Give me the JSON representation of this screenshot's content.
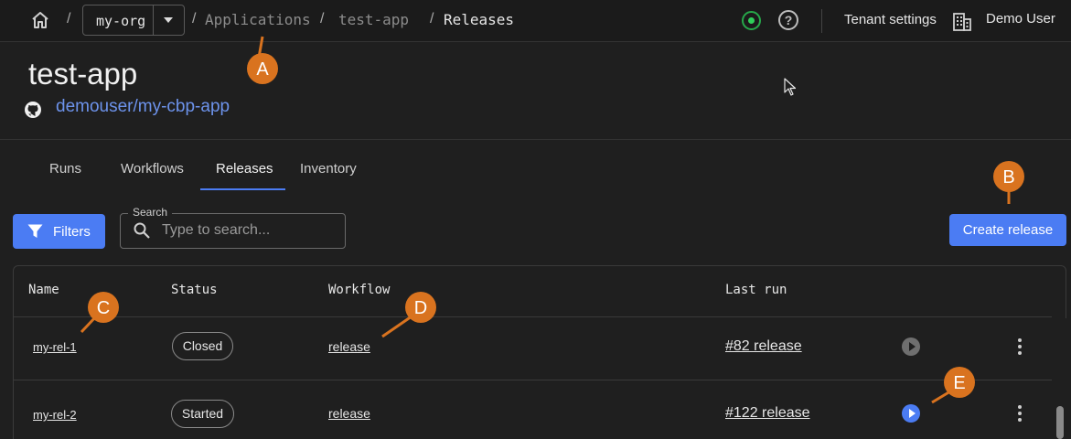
{
  "topbar": {
    "org": "my-org",
    "breadcrumbs": [
      "Applications",
      "test-app",
      "Releases"
    ],
    "separator": "/",
    "tenant_settings": "Tenant settings",
    "user": "Demo User",
    "help_glyph": "?"
  },
  "header": {
    "title": "test-app",
    "repo": "demouser/my-cbp-app"
  },
  "tabs": [
    {
      "label": "Runs",
      "active": false
    },
    {
      "label": "Workflows",
      "active": false
    },
    {
      "label": "Releases",
      "active": true
    },
    {
      "label": "Inventory",
      "active": false
    }
  ],
  "toolbar": {
    "filters_label": "Filters",
    "search_label": "Search",
    "search_placeholder": "Type to search...",
    "create_label": "Create release"
  },
  "table": {
    "columns": [
      "Name",
      "Status",
      "Workflow",
      "Last run"
    ],
    "rows": [
      {
        "name": "my-rel-1",
        "status": "Closed",
        "workflow": "release",
        "last_run": "#82 release",
        "play_state": "disabled"
      },
      {
        "name": "my-rel-2",
        "status": "Started",
        "workflow": "release",
        "last_run": "#122 release",
        "play_state": "enabled"
      }
    ]
  },
  "callouts": [
    "A",
    "B",
    "C",
    "D",
    "E"
  ],
  "colors": {
    "accent": "#4b7cf3",
    "callout": "#d9731f",
    "link": "#6d93ec",
    "status_ok": "#2fd05a"
  }
}
